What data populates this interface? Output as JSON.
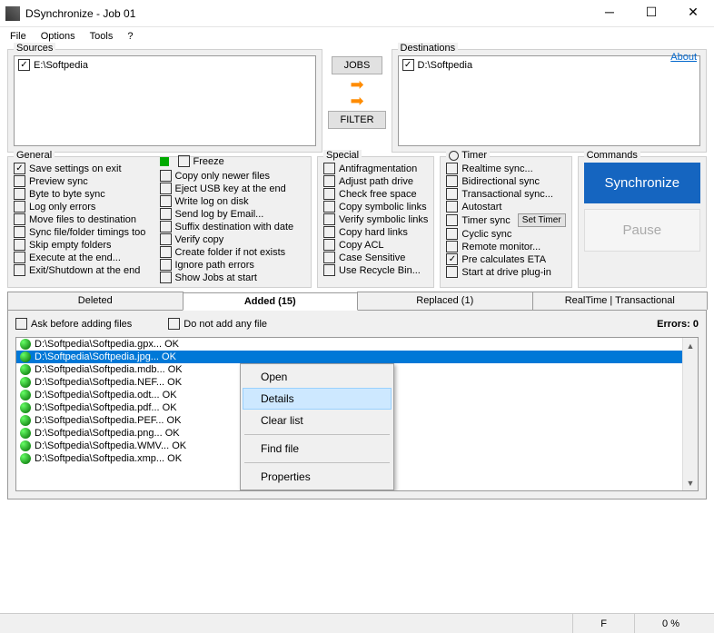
{
  "window": {
    "title": "DSynchronize - Job 01"
  },
  "menu": {
    "file": "File",
    "options": "Options",
    "tools": "Tools",
    "help": "?"
  },
  "top": {
    "sourcesLabel": "Sources",
    "destinationsLabel": "Destinations",
    "aboutLabel": "About",
    "sourceItem": "E:\\Softpedia",
    "destItem": "D:\\Softpedia",
    "jobsBtn": "JOBS",
    "filterBtn": "FILTER"
  },
  "general": {
    "label": "General",
    "freezeLabel": "Freeze",
    "col1": [
      "Save settings on exit",
      "Preview sync",
      "Byte to byte sync",
      "Log only errors",
      "Move files to destination",
      "Sync file/folder timings too",
      "Skip empty folders",
      "Execute at the end...",
      "Exit/Shutdown at the end"
    ],
    "col1Checked": [
      true,
      false,
      false,
      false,
      false,
      false,
      false,
      false,
      false
    ],
    "col2": [
      "Copy only newer files",
      "Eject USB key at the end",
      "Write log on disk",
      "Send log by Email...",
      "Suffix destination with date",
      "Verify copy",
      "Create folder if not exists",
      "Ignore path errors",
      "Show Jobs at start"
    ]
  },
  "special": {
    "label": "Special",
    "items": [
      "Antifragmentation",
      "Adjust path drive",
      "Check free space",
      "Copy symbolic links",
      "Verify symbolic links",
      "Copy hard links",
      "Copy ACL",
      "Case Sensitive",
      "Use Recycle Bin..."
    ]
  },
  "timer": {
    "label": "Timer",
    "items": [
      "Realtime sync...",
      "Bidirectional sync",
      "Transactional sync...",
      "Autostart",
      "Timer sync",
      "Cyclic sync",
      "Remote monitor...",
      "Pre calculates ETA",
      "Start at drive plug-in"
    ],
    "checked": [
      false,
      false,
      false,
      false,
      false,
      false,
      false,
      true,
      false
    ],
    "setTimer": "Set Timer"
  },
  "commands": {
    "label": "Commands",
    "sync": "Synchronize",
    "pause": "Pause"
  },
  "tabs": {
    "deleted": "Deleted",
    "added": "Added (15)",
    "replaced": "Replaced (1)",
    "realtime": "RealTime | Transactional"
  },
  "tabOptions": {
    "askBefore": "Ask before adding files",
    "doNotAdd": "Do not add any file",
    "errors": "Errors: 0"
  },
  "files": [
    "D:\\Softpedia\\Softpedia.gpx... OK",
    "D:\\Softpedia\\Softpedia.jpg... OK",
    "D:\\Softpedia\\Softpedia.mdb... OK",
    "D:\\Softpedia\\Softpedia.NEF... OK",
    "D:\\Softpedia\\Softpedia.odt... OK",
    "D:\\Softpedia\\Softpedia.pdf... OK",
    "D:\\Softpedia\\Softpedia.PEF... OK",
    "D:\\Softpedia\\Softpedia.png... OK",
    "D:\\Softpedia\\Softpedia.WMV... OK",
    "D:\\Softpedia\\Softpedia.xmp... OK"
  ],
  "selectedFileIndex": 1,
  "contextMenu": {
    "open": "Open",
    "details": "Details",
    "clear": "Clear list",
    "find": "Find file",
    "props": "Properties"
  },
  "status": {
    "f": "F",
    "pct": "0 %"
  }
}
